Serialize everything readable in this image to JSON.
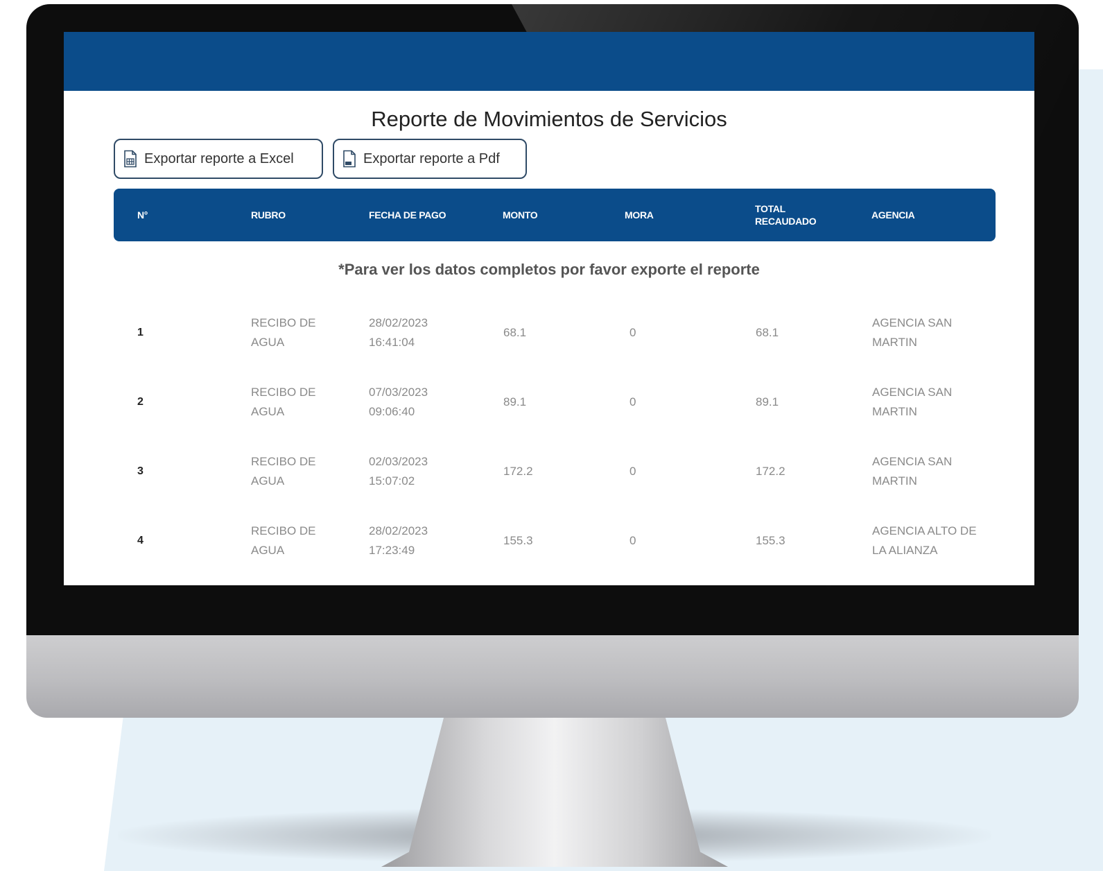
{
  "report": {
    "title": "Reporte de Movimientos de Servicios",
    "export_excel_label": "Exportar reporte a Excel",
    "export_pdf_label": "Exportar reporte a Pdf",
    "notice": "*Para ver los datos completos por favor exporte el reporte"
  },
  "table": {
    "columns": [
      "N°",
      "RUBRO",
      "FECHA DE PAGO",
      "MONTO",
      "MORA",
      "TOTAL RECAUDADO",
      "AGENCIA"
    ],
    "rows": [
      [
        "1",
        "RECIBO DE AGUA",
        "28/02/2023 16:41:04",
        "68.1",
        "0",
        "68.1",
        "AGENCIA SAN MARTIN"
      ],
      [
        "2",
        "RECIBO DE AGUA",
        "07/03/2023 09:06:40",
        "89.1",
        "0",
        "89.1",
        "AGENCIA SAN MARTIN"
      ],
      [
        "3",
        "RECIBO DE AGUA",
        "02/03/2023 15:07:02",
        "172.2",
        "0",
        "172.2",
        "AGENCIA SAN MARTIN"
      ],
      [
        "4",
        "RECIBO DE AGUA",
        "28/02/2023 17:23:49",
        "155.3",
        "0",
        "155.3",
        "AGENCIA ALTO DE LA ALIANZA"
      ]
    ]
  },
  "icons": {
    "excel": "spreadsheet-file-icon",
    "pdf": "pdf-file-icon"
  },
  "colors": {
    "header_blue": "#0b4c8a",
    "button_border": "#2f4a66",
    "cell_text": "#8a8a8a",
    "background_panel": "#e6f1f8"
  }
}
